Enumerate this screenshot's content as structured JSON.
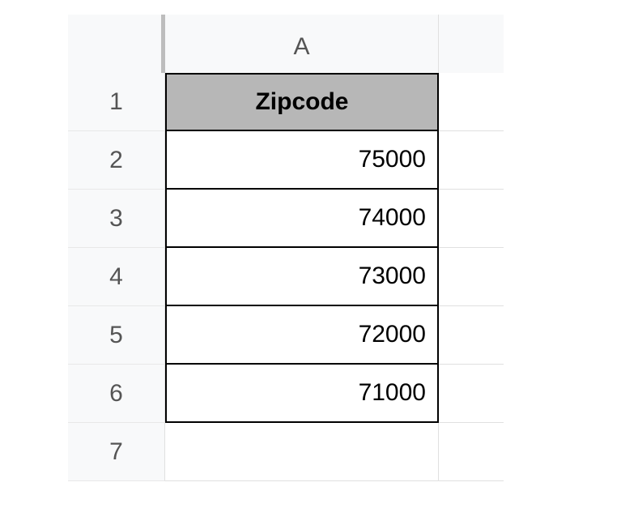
{
  "sheet": {
    "col_headers": [
      "A"
    ],
    "row_headers": [
      "1",
      "2",
      "3",
      "4",
      "5",
      "6",
      "7"
    ],
    "table_header": "Zipcode",
    "data": [
      "75000",
      "74000",
      "73000",
      "72000",
      "71000"
    ]
  }
}
